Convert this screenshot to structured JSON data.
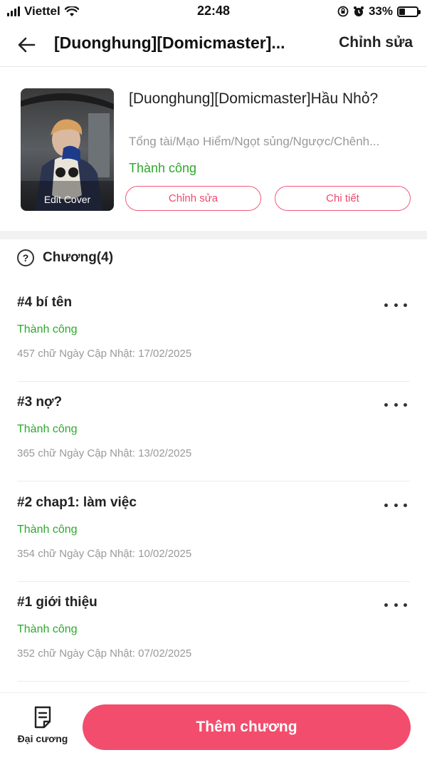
{
  "status_bar": {
    "carrier": "Viettel",
    "time": "22:48",
    "battery": "33%",
    "battery_level": 0.33
  },
  "header": {
    "title": "[Duonghung][Domicmaster]...",
    "edit_label": "Chỉnh sửa"
  },
  "book": {
    "title": "[Duonghung][Domicmaster]Hầu Nhỏ?",
    "genres": "Tổng tài/Mạo Hiểm/Ngọt sủng/Ngược/Chênh...",
    "status": "Thành công",
    "cover_label": "Edit Cover",
    "edit_button": "Chỉnh sửa",
    "detail_button": "Chi tiết"
  },
  "chapters_header": "Chương(4)",
  "chapters": [
    {
      "title": "#4 bí tên",
      "status": "Thành công",
      "meta": "457 chữ Ngày Cập Nhật: 17/02/2025"
    },
    {
      "title": "#3 nợ?",
      "status": "Thành công",
      "meta": "365 chữ Ngày Cập Nhật: 13/02/2025"
    },
    {
      "title": "#2 chap1: làm việc",
      "status": "Thành công",
      "meta": "354 chữ Ngày Cập Nhật: 10/02/2025"
    },
    {
      "title": "#1 giới thiệu",
      "status": "Thành công",
      "meta": "352 chữ Ngày Cập Nhật: 07/02/2025"
    }
  ],
  "bottom_bar": {
    "outline_label": "Đại cương",
    "add_chapter_label": "Thêm chương"
  },
  "colors": {
    "accent": "#f24d6d",
    "success": "#2ea82e"
  }
}
